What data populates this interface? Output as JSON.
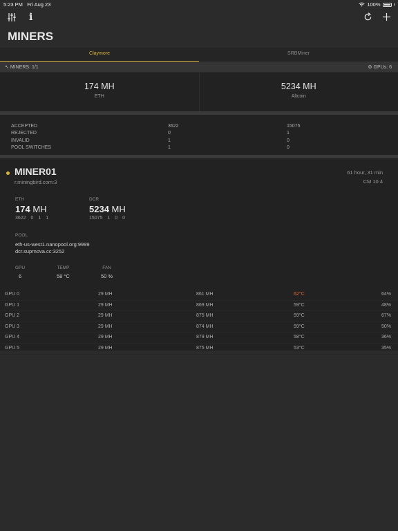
{
  "status": {
    "time": "5:23 PM",
    "date": "Fri Aug 23",
    "battery": "100%"
  },
  "nav": {
    "icons": [
      "sliders-icon",
      "info-icon",
      "refresh-icon",
      "plus-icon"
    ],
    "title": "MINERS"
  },
  "tabs": [
    {
      "label": "Claymore",
      "active": true
    },
    {
      "label": "SRBMiner",
      "active": false
    }
  ],
  "infobar": {
    "miners": "MINERS: 1/1",
    "gpus": "GPUs: 6"
  },
  "summary": [
    {
      "value": "174 MH",
      "label": "ETH"
    },
    {
      "value": "5234 MH",
      "label": "Altcoin"
    }
  ],
  "stats": [
    {
      "label": "ACCEPTED",
      "v1": "3622",
      "v2": "15075"
    },
    {
      "label": "REJECTED",
      "v1": "0",
      "v2": "1"
    },
    {
      "label": "INVALID",
      "v1": "1",
      "v2": "0"
    },
    {
      "label": "POOL SWITCHES",
      "v1": "1",
      "v2": "0"
    }
  ],
  "miner": {
    "name": "MINER01",
    "host": "r.miningbird.com:3",
    "uptime": "61 hour, 31 min",
    "version": "CM 10.4",
    "eth": {
      "label": "ETH",
      "value": "174",
      "unit": "MH",
      "sub": "3622 0 1 1"
    },
    "dcr": {
      "label": "DCR",
      "value": "5234",
      "unit": "MH",
      "sub": "15075 1 0 0"
    },
    "pool": {
      "label": "POOL",
      "lines": [
        "eth-us-west1.nanopool.org:9999",
        "dcr.suprnova.cc:3252"
      ]
    },
    "gpu": {
      "label": "GPU",
      "value": "6"
    },
    "temp": {
      "label": "TEMP",
      "value": "58 °C"
    },
    "fan": {
      "label": "FAN",
      "value": "50 %"
    }
  },
  "gpus": [
    {
      "name": "GPU 0",
      "eth": "29 MH",
      "alt": "861 MH",
      "temp": "62°C",
      "fan": "64%",
      "hot": true
    },
    {
      "name": "GPU 1",
      "eth": "29 MH",
      "alt": "869 MH",
      "temp": "59°C",
      "fan": "48%",
      "hot": false
    },
    {
      "name": "GPU 2",
      "eth": "29 MH",
      "alt": "875 MH",
      "temp": "59°C",
      "fan": "67%",
      "hot": false
    },
    {
      "name": "GPU 3",
      "eth": "29 MH",
      "alt": "874 MH",
      "temp": "59°C",
      "fan": "50%",
      "hot": false
    },
    {
      "name": "GPU 4",
      "eth": "29 MH",
      "alt": "879 MH",
      "temp": "58°C",
      "fan": "36%",
      "hot": false
    },
    {
      "name": "GPU 5",
      "eth": "29 MH",
      "alt": "875 MH",
      "temp": "53°C",
      "fan": "35%",
      "hot": false
    }
  ],
  "colors": {
    "accent": "#d9b43a",
    "hot": "#e0673a",
    "background": "#2b2b2b"
  }
}
